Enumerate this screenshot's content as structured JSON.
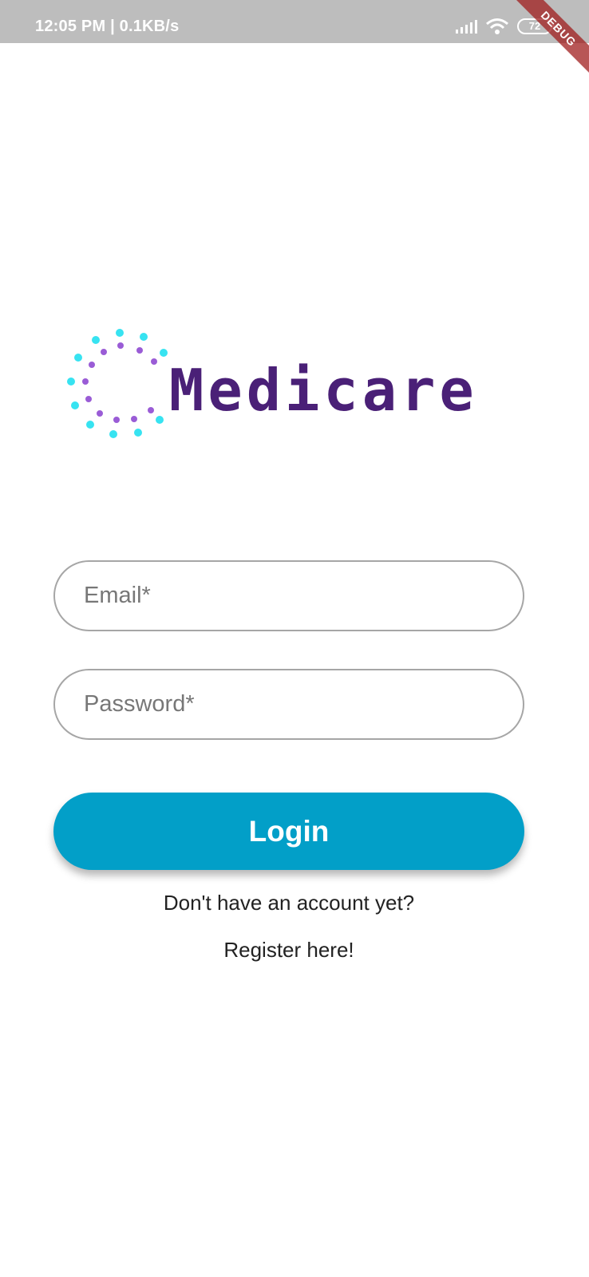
{
  "status_bar": {
    "time": "12:05 PM | 0.1KB/s",
    "battery": "72",
    "debug_label": "DEBUG"
  },
  "logo": {
    "text": "Medicare",
    "color": "#4a2077",
    "dot_colors": [
      "#37e3f1",
      "#9a5cd6"
    ]
  },
  "form": {
    "email_placeholder": "Email*",
    "password_placeholder": "Password*",
    "login_label": "Login",
    "login_color": "#029fc8"
  },
  "footer": {
    "prompt": "Don't have an account yet?",
    "register_label": "Register here!"
  }
}
